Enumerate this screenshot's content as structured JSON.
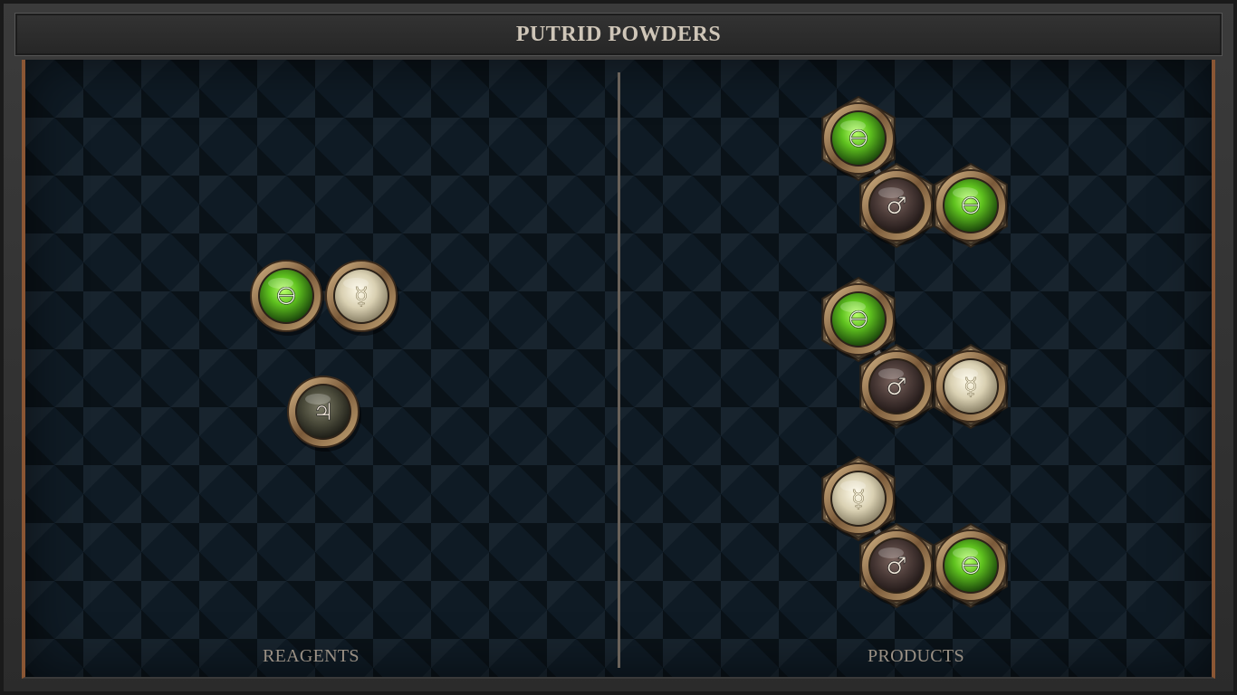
{
  "title": "PUTRID POWDERS",
  "panels": {
    "left_label": "REAGENTS",
    "right_label": "PRODUCTS"
  },
  "colors": {
    "salt_green": "#5fc21f",
    "mercury_cream": "#e8e1c8",
    "iron_brown": "#4a3a37",
    "lead_dark": "#4a4a3a",
    "frame_copper": "#8a5634",
    "board_blue": "#0f1b25"
  },
  "atoms": {
    "salt": {
      "name": "salt-atom",
      "symbol": "🜔",
      "icon": "salt-earth-icon"
    },
    "mercury": {
      "name": "mercury-atom",
      "symbol": "☿",
      "icon": "mercury-icon"
    },
    "iron": {
      "name": "iron-atom",
      "symbol": "♂",
      "icon": "iron-mars-icon"
    },
    "lead": {
      "name": "lead-atom",
      "symbol": "♃",
      "icon": "tin-jupiter-icon"
    }
  },
  "reagents": [
    {
      "atoms": [
        "salt",
        "mercury"
      ]
    },
    {
      "atoms": [
        "lead"
      ]
    }
  ],
  "products": [
    {
      "atoms": [
        "salt",
        "iron",
        "salt"
      ]
    },
    {
      "atoms": [
        "salt",
        "iron",
        "mercury"
      ]
    },
    {
      "atoms": [
        "mercury",
        "iron",
        "salt"
      ]
    }
  ]
}
